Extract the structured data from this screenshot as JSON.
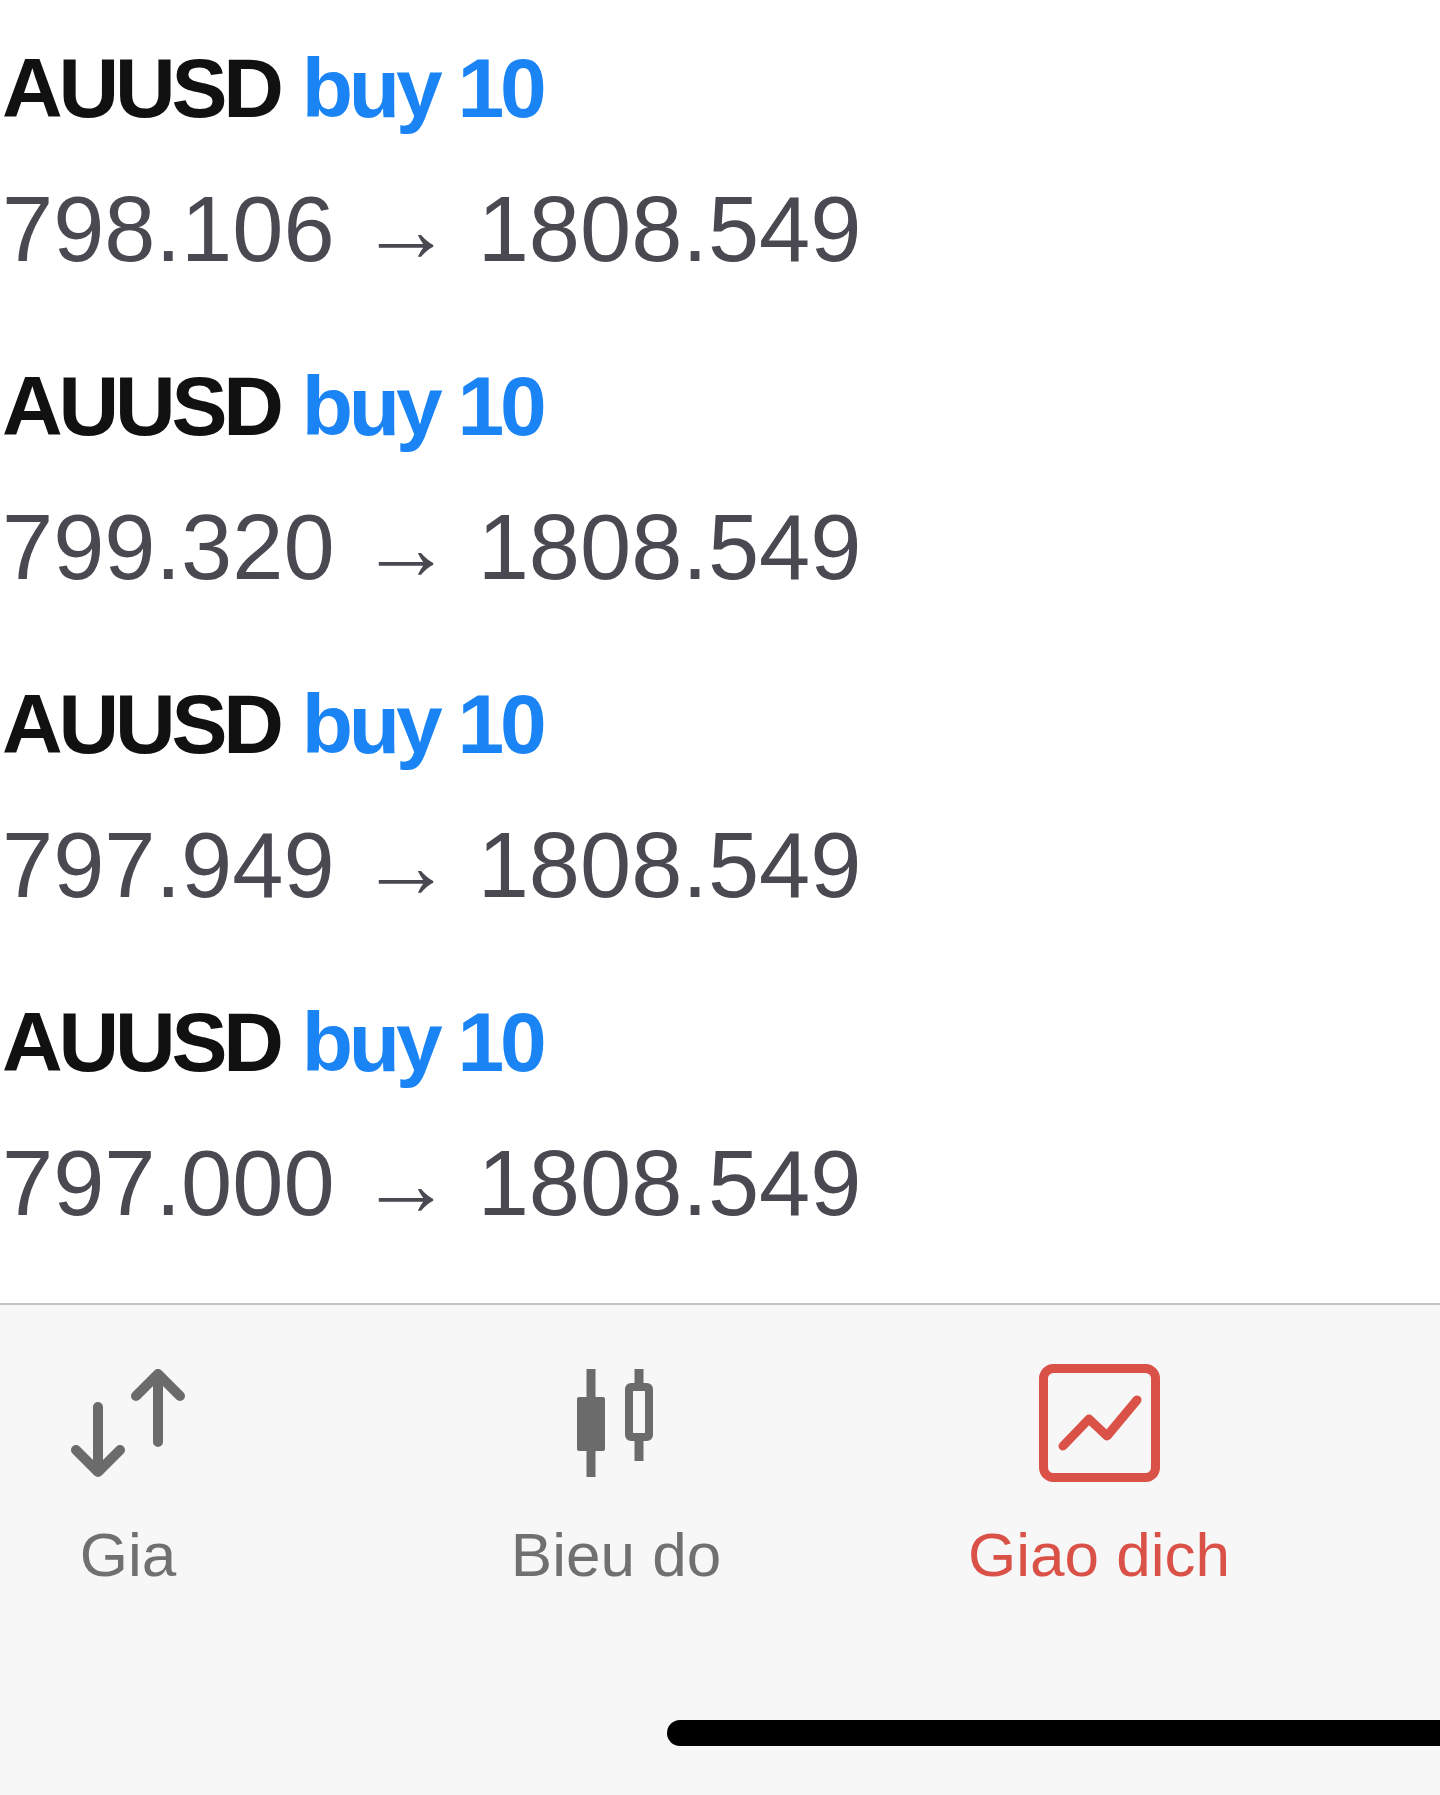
{
  "trades": [
    {
      "symbol": "AUUSD",
      "order": "buy 10",
      "prices": "798.106 → 1808.549"
    },
    {
      "symbol": "AUUSD",
      "order": "buy 10",
      "prices": "799.320 → 1808.549"
    },
    {
      "symbol": "AUUSD",
      "order": "buy 10",
      "prices": "797.949 → 1808.549"
    },
    {
      "symbol": "AUUSD",
      "order": "buy 10",
      "prices": "797.000 → 1808.549"
    }
  ],
  "tab_bar": {
    "tabs": [
      {
        "label": "Gia",
        "selected": false
      },
      {
        "label": "Bieu do",
        "selected": false
      },
      {
        "label": "Giao dich",
        "selected": true
      }
    ]
  }
}
